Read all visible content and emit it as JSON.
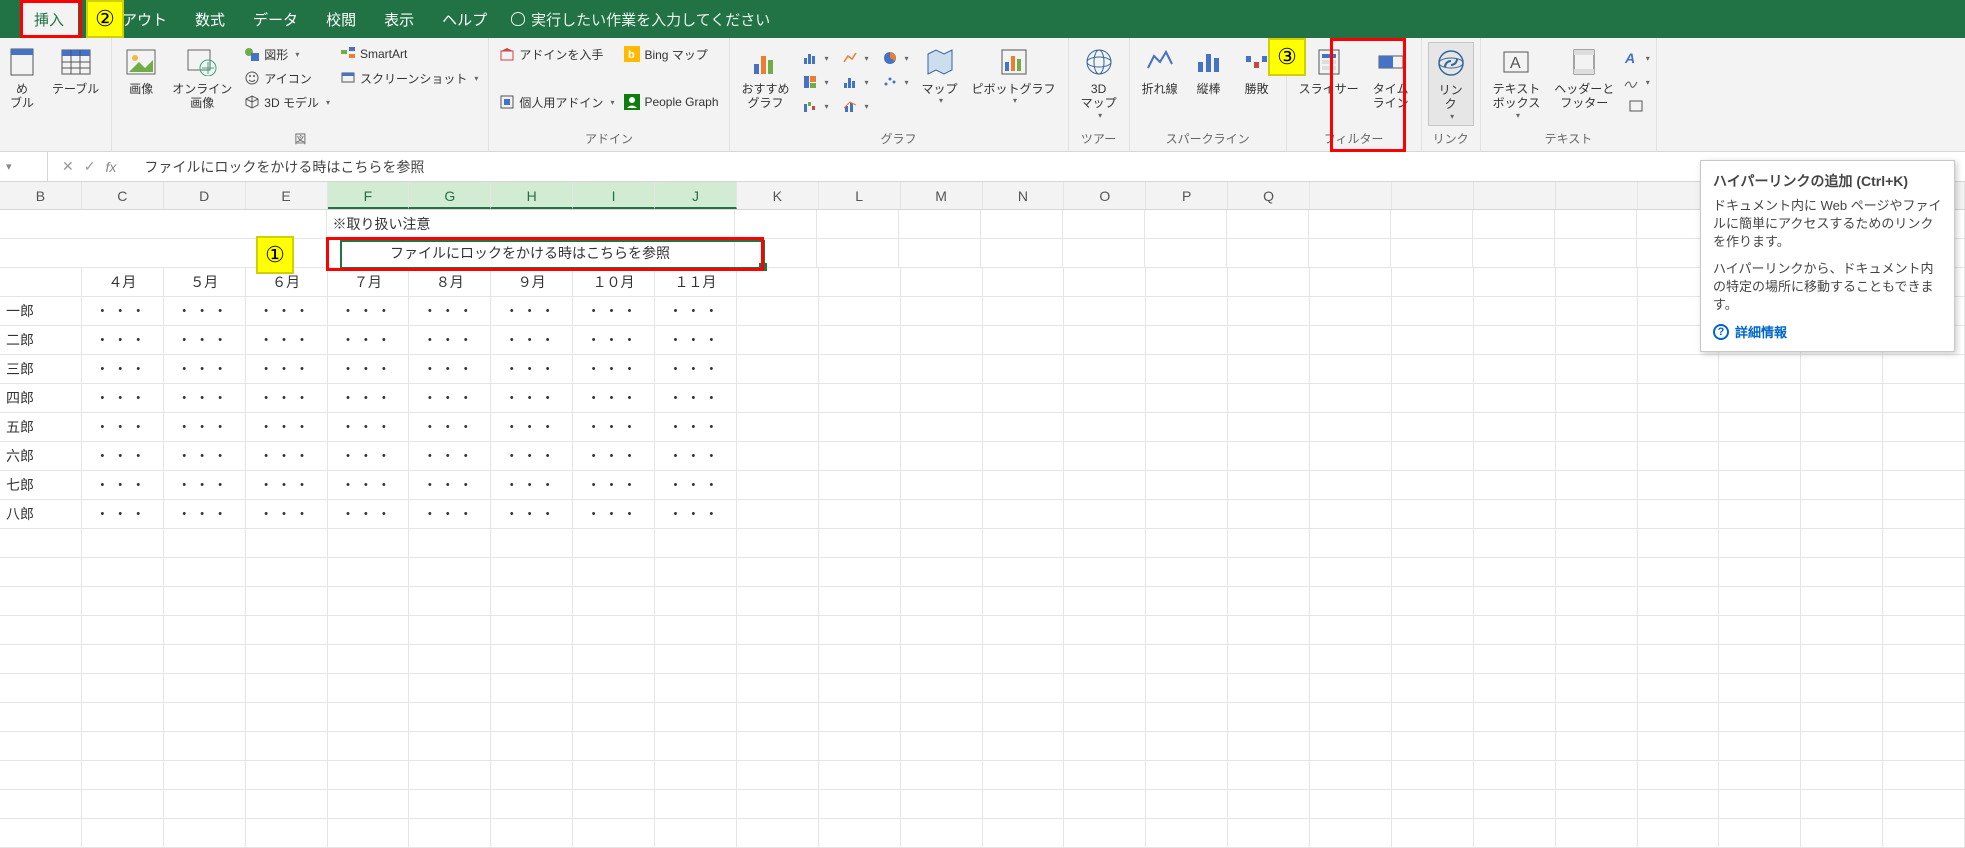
{
  "menu": {
    "tabs": [
      "挿入",
      "レイアウト",
      "数式",
      "データ",
      "校閲",
      "表示",
      "ヘルプ"
    ],
    "active_index": 0,
    "tellme": "実行したい作業を入力してください"
  },
  "ribbon": {
    "tables": {
      "btn1": "め\nブル",
      "btn2": "テーブル",
      "label": ""
    },
    "illustrations": {
      "image": "画像",
      "online_image": "オンライン\n画像",
      "shapes": "図形",
      "icons": "アイコン",
      "model3d": "3D モデル",
      "smartart": "SmartArt",
      "screenshot": "スクリーンショット",
      "label": "図"
    },
    "addins": {
      "get": "アドインを入手",
      "my": "個人用アドイン",
      "bing": "Bing マップ",
      "people": "People Graph",
      "label": "アドイン"
    },
    "charts": {
      "recommend": "おすすめ\nグラフ",
      "map": "マップ",
      "pivot": "ピボットグラフ",
      "label": "グラフ"
    },
    "tours": {
      "map3d": "3D\nマップ",
      "label": "ツアー"
    },
    "sparklines": {
      "line": "折れ線",
      "column": "縦棒",
      "winloss": "勝敗",
      "label": "スパークライン"
    },
    "filter": {
      "slicer": "スライサー",
      "timeline": "タイム\nライン",
      "label": "フィルター"
    },
    "links": {
      "link": "リン\nク",
      "label": "リンク"
    },
    "text": {
      "textbox": "テキスト\nボックス",
      "header": "ヘッダーと\nフッター",
      "label": "テキスト"
    }
  },
  "formula_bar": {
    "content": "ファイルにロックをかける時はこちらを参照"
  },
  "columns": [
    "B",
    "C",
    "D",
    "E",
    "F",
    "G",
    "H",
    "I",
    "J",
    "K",
    "L",
    "M",
    "N",
    "O",
    "P",
    "Q"
  ],
  "selected_cols": [
    "F",
    "G",
    "H",
    "I",
    "J"
  ],
  "sheet": {
    "note": "※取り扱い注意",
    "merged_text": "ファイルにロックをかける時はこちらを参照",
    "months": [
      "４月",
      "５月",
      "６月",
      "７月",
      "８月",
      "９月",
      "１０月",
      "１１月"
    ],
    "names": [
      "一郎",
      "二郎",
      "三郎",
      "四郎",
      "五郎",
      "六郎",
      "七郎",
      "八郎"
    ],
    "dots": "・・・"
  },
  "annotations": {
    "n1": "①",
    "n2": "②",
    "n3": "③"
  },
  "tooltip": {
    "title": "ハイパーリンクの追加 (Ctrl+K)",
    "p1": "ドキュメント内に Web ページやファイルに簡単にアクセスするためのリンクを作ります。",
    "p2": "ハイパーリンクから、ドキュメント内の特定の場所に移動することもできます。",
    "more": "詳細情報"
  }
}
